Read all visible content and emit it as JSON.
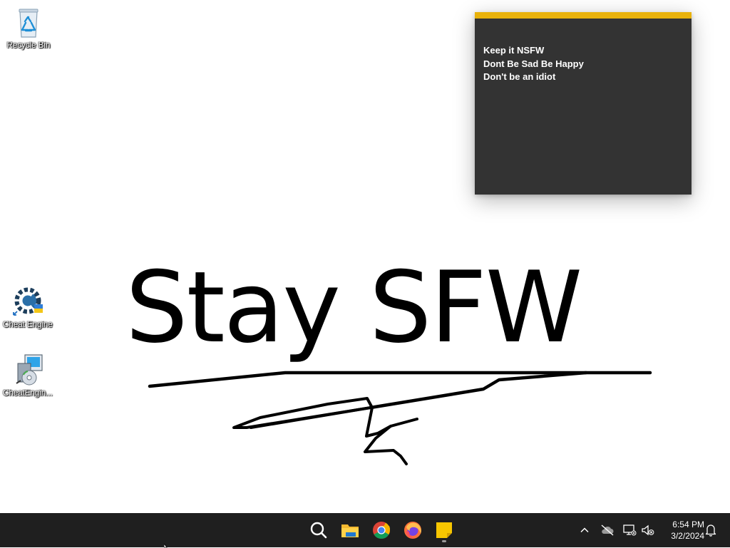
{
  "desktop": {
    "wallpaper_text": "Stay SFW",
    "icons": [
      {
        "label": "Recycle Bin",
        "icon": "recycle-bin-icon"
      },
      {
        "label": "Cheat Engine",
        "icon": "cheat-engine-icon"
      },
      {
        "label": "CheatEngin...",
        "icon": "cheat-engine-installer-icon"
      }
    ]
  },
  "sticky_note": {
    "accent_color": "#e9b20b",
    "lines": [
      "Keep it NSFW",
      "Dont Be Sad Be Happy",
      "Don't be an idiot"
    ]
  },
  "taskbar": {
    "apps": [
      {
        "name": "Search",
        "icon": "search-icon"
      },
      {
        "name": "File Explorer",
        "icon": "file-explorer-icon"
      },
      {
        "name": "Google Chrome",
        "icon": "chrome-icon"
      },
      {
        "name": "Firefox",
        "icon": "firefox-icon"
      },
      {
        "name": "Sticky Notes",
        "icon": "sticky-notes-icon",
        "running": true
      }
    ],
    "tray": {
      "icons": [
        "chevron-up-icon",
        "cloud-offline-icon",
        "network-icon",
        "volume-muted-icon",
        "notification-bell-icon"
      ],
      "time": "6:54 PM",
      "date": "3/2/2024"
    }
  }
}
